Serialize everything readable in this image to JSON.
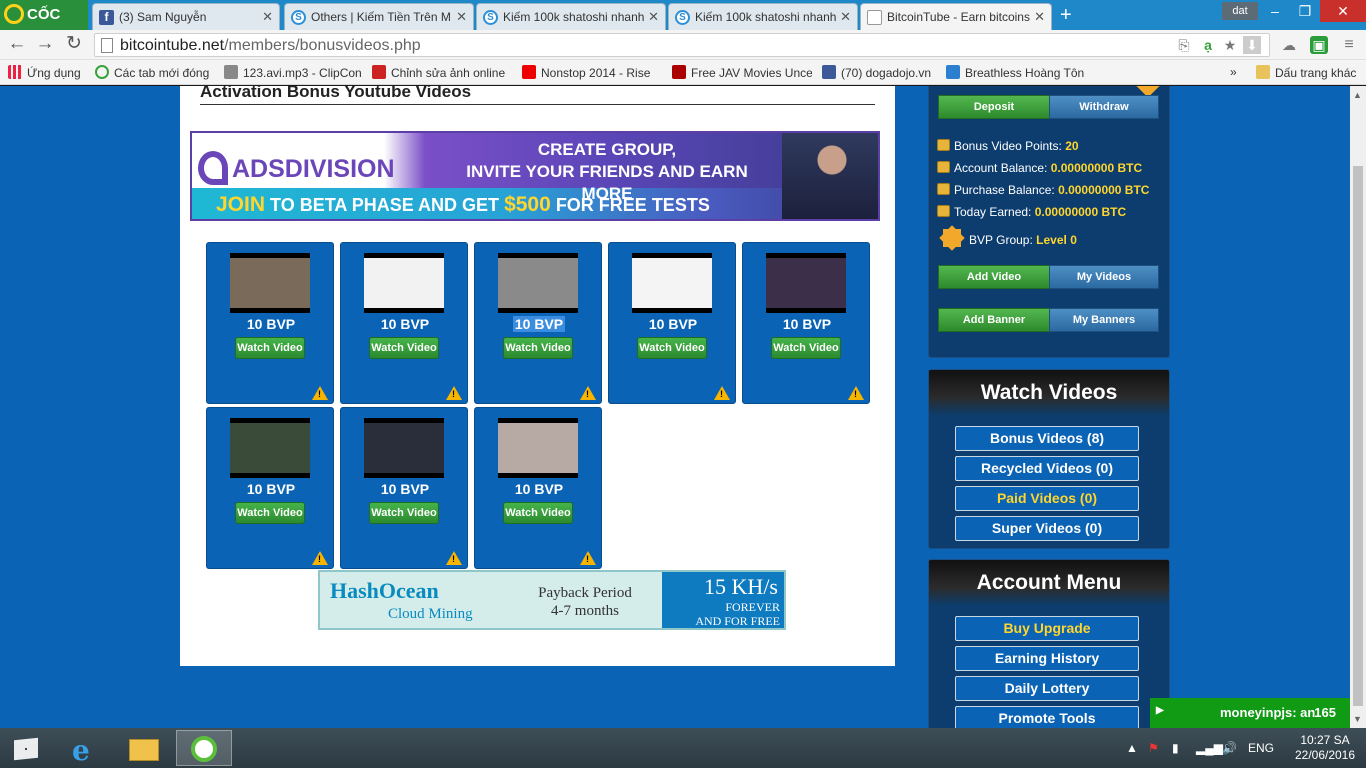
{
  "browser": {
    "brand": "CỐC CỐC",
    "tabs": [
      {
        "label": "(3) Sam Nguyễn",
        "favicon": "facebook-icon"
      },
      {
        "label": "Others | Kiếm Tiền Trên M",
        "favicon": "satoshi-icon"
      },
      {
        "label": "Kiếm 100k shatoshi nhanh",
        "favicon": "satoshi-icon"
      },
      {
        "label": "Kiếm 100k shatoshi nhanh",
        "favicon": "satoshi-icon"
      },
      {
        "label": "BitcoinTube - Earn bitcoins",
        "favicon": "page-icon",
        "active": true
      }
    ],
    "new_tab": "+",
    "user": "dat",
    "window_controls": {
      "minimize": "–",
      "restore": "❐",
      "close": "✕"
    },
    "url_host": "bitcointube.net",
    "url_path": "/members/bonusvideos.php",
    "bookmarks": [
      {
        "label": "Ứng dụng",
        "icon": "apps-grid-icon"
      },
      {
        "label": "Các tab mới đóng",
        "icon": "history-icon"
      },
      {
        "label": "123.avi.mp3 - ClipCon",
        "icon": "music-icon"
      },
      {
        "label": "Chỉnh sửa ảnh online",
        "icon": "photo-edit-icon"
      },
      {
        "label": "Nonstop 2014 - Rise",
        "icon": "youtube-icon"
      },
      {
        "label": "Free JAV Movies Unce",
        "icon": "tv-icon"
      },
      {
        "label": "(70) dogadojo.vn",
        "icon": "facebook-icon"
      },
      {
        "label": "Breathless Hoàng Tôn",
        "icon": "zing-icon"
      }
    ],
    "bookmarks_overflow": "»",
    "bookmarks_other": "Dấu trang khác"
  },
  "page": {
    "section_title": "Activation Bonus Youtube Videos",
    "ad_top": {
      "brand": "ADSDIVISION",
      "headline_1": "CREATE GROUP,",
      "headline_2": "INVITE YOUR FRIENDS AND EARN MORE",
      "cta_join": "JOIN",
      "cta_mid": "TO BETA PHASE AND GET",
      "cta_amount": "$500",
      "cta_end": "FOR FREE TESTS"
    },
    "videos": [
      {
        "points": "10 BVP",
        "button": "Watch Video",
        "thumb_color": "#7a6a5a",
        "selected": false
      },
      {
        "points": "10 BVP",
        "button": "Watch Video",
        "thumb_color": "#f2f2f2",
        "selected": false
      },
      {
        "points": "10 BVP",
        "button": "Watch Video",
        "thumb_color": "#8a8a8a",
        "selected": true
      },
      {
        "points": "10 BVP",
        "button": "Watch Video",
        "thumb_color": "#f4f4f4",
        "selected": false
      },
      {
        "points": "10 BVP",
        "button": "Watch Video",
        "thumb_color": "#3c2f4a",
        "selected": false
      },
      {
        "points": "10 BVP",
        "button": "Watch Video",
        "thumb_color": "#3a4b3a",
        "selected": false
      },
      {
        "points": "10 BVP",
        "button": "Watch Video",
        "thumb_color": "#2a2e3a",
        "selected": false
      },
      {
        "points": "10 BVP",
        "button": "Watch Video",
        "thumb_color": "#b7aaa4",
        "selected": false
      }
    ],
    "ad_bottom": {
      "brand": "HashOcean",
      "sub": "Cloud Mining",
      "payback_1": "Payback Period",
      "payback_2": "4-7 months",
      "speed": "15 KH/s",
      "forever": "FOREVER",
      "free": "AND  FOR FREE"
    }
  },
  "account": {
    "deposit": "Deposit",
    "withdraw": "Withdraw",
    "stats": [
      {
        "label": "Bonus Video Points:",
        "value": "20"
      },
      {
        "label": "Account Balance:",
        "value": "0.00000000 BTC"
      },
      {
        "label": "Purchase Balance:",
        "value": "0.00000000 BTC"
      },
      {
        "label": "Today Earned:",
        "value": "0.00000000 BTC"
      }
    ],
    "bvp_group_label": "BVP Group:",
    "bvp_group_value": "Level 0",
    "add_video": "Add Video",
    "my_videos": "My Videos",
    "add_banner": "Add Banner",
    "my_banners": "My Banners"
  },
  "watch_videos": {
    "title": "Watch Videos",
    "items": [
      {
        "label": "Bonus Videos (8)",
        "gold": false
      },
      {
        "label": "Recycled Videos (0)",
        "gold": false
      },
      {
        "label": "Paid Videos (0)",
        "gold": true
      },
      {
        "label": "Super Videos (0)",
        "gold": false
      }
    ]
  },
  "account_menu": {
    "title": "Account Menu",
    "items": [
      {
        "label": "Buy Upgrade",
        "gold": true
      },
      {
        "label": "Earning History",
        "gold": false
      },
      {
        "label": "Daily Lottery",
        "gold": false
      },
      {
        "label": "Promote Tools",
        "gold": false
      }
    ]
  },
  "chat": {
    "user": "moneyinpjs: an",
    "count": "165"
  },
  "taskbar": {
    "lang": "ENG",
    "time": "10:27 SA",
    "date": "22/06/2016"
  }
}
